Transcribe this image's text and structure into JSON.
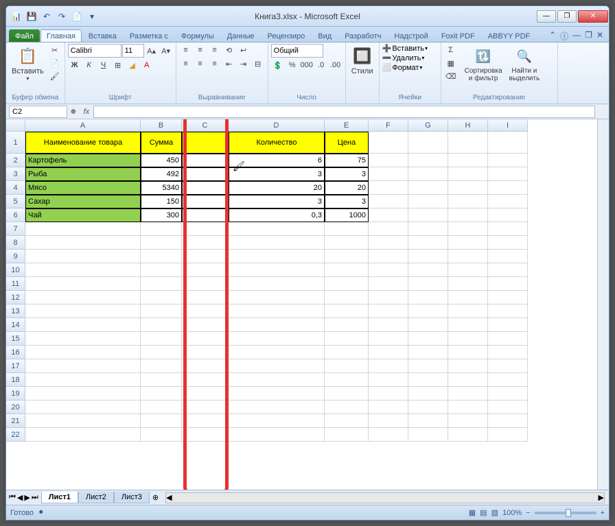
{
  "window": {
    "title": "Книга3.xlsx - Microsoft Excel"
  },
  "qat": {
    "save": "💾",
    "undo": "↶",
    "redo": "↷",
    "new": "📄"
  },
  "winbuttons": {
    "min": "—",
    "max": "❐",
    "close": "✕"
  },
  "tabs": {
    "file": "Файл",
    "items": [
      "Главная",
      "Вставка",
      "Разметка с",
      "Формулы",
      "Данные",
      "Рецензиро",
      "Вид",
      "Разработч",
      "Надстрой",
      "Foxit PDF",
      "ABBYY PDF"
    ],
    "active_index": 0
  },
  "ribbon": {
    "clipboard": {
      "paste": "Вставить",
      "label": "Буфер обмена"
    },
    "font": {
      "name": "Calibri",
      "size": "11",
      "bold": "Ж",
      "italic": "К",
      "underline": "Ч",
      "label": "Шрифт"
    },
    "alignment": {
      "label": "Выравнивание"
    },
    "number": {
      "format": "Общий",
      "label": "Число"
    },
    "styles": {
      "btn": "Стили",
      "label": ""
    },
    "cells": {
      "insert": "Вставить",
      "delete": "Удалить",
      "format": "Формат",
      "label": "Ячейки"
    },
    "editing": {
      "sort": "Сортировка\nи фильтр",
      "find": "Найти и\nвыделить",
      "label": "Редактирование"
    }
  },
  "namebox": "C2",
  "columns": [
    "A",
    "B",
    "C",
    "D",
    "E",
    "F",
    "G",
    "H",
    "I"
  ],
  "row_headers": [
    "1",
    "2",
    "3",
    "4",
    "5",
    "6",
    "7",
    "8",
    "9",
    "10",
    "11",
    "12",
    "13",
    "14",
    "15",
    "16",
    "17",
    "18",
    "19",
    "20",
    "21",
    "22"
  ],
  "table": {
    "headers": {
      "a": "Наименование товара",
      "b": "Сумма",
      "d": "Количество",
      "e": "Цена"
    },
    "rows": [
      {
        "a": "Картофель",
        "b": "450",
        "d": "6",
        "e": "75"
      },
      {
        "a": "Рыба",
        "b": "492",
        "d": "3",
        "e": "3"
      },
      {
        "a": "Мясо",
        "b": "5340",
        "d": "20",
        "e": "20"
      },
      {
        "a": "Сахар",
        "b": "150",
        "d": "3",
        "e": "3"
      },
      {
        "a": "Чай",
        "b": "300",
        "d": "0,3",
        "e": "1000"
      }
    ]
  },
  "sheets": {
    "items": [
      "Лист1",
      "Лист2",
      "Лист3"
    ],
    "active": 0
  },
  "status": {
    "ready": "Готово",
    "zoom": "100%"
  }
}
